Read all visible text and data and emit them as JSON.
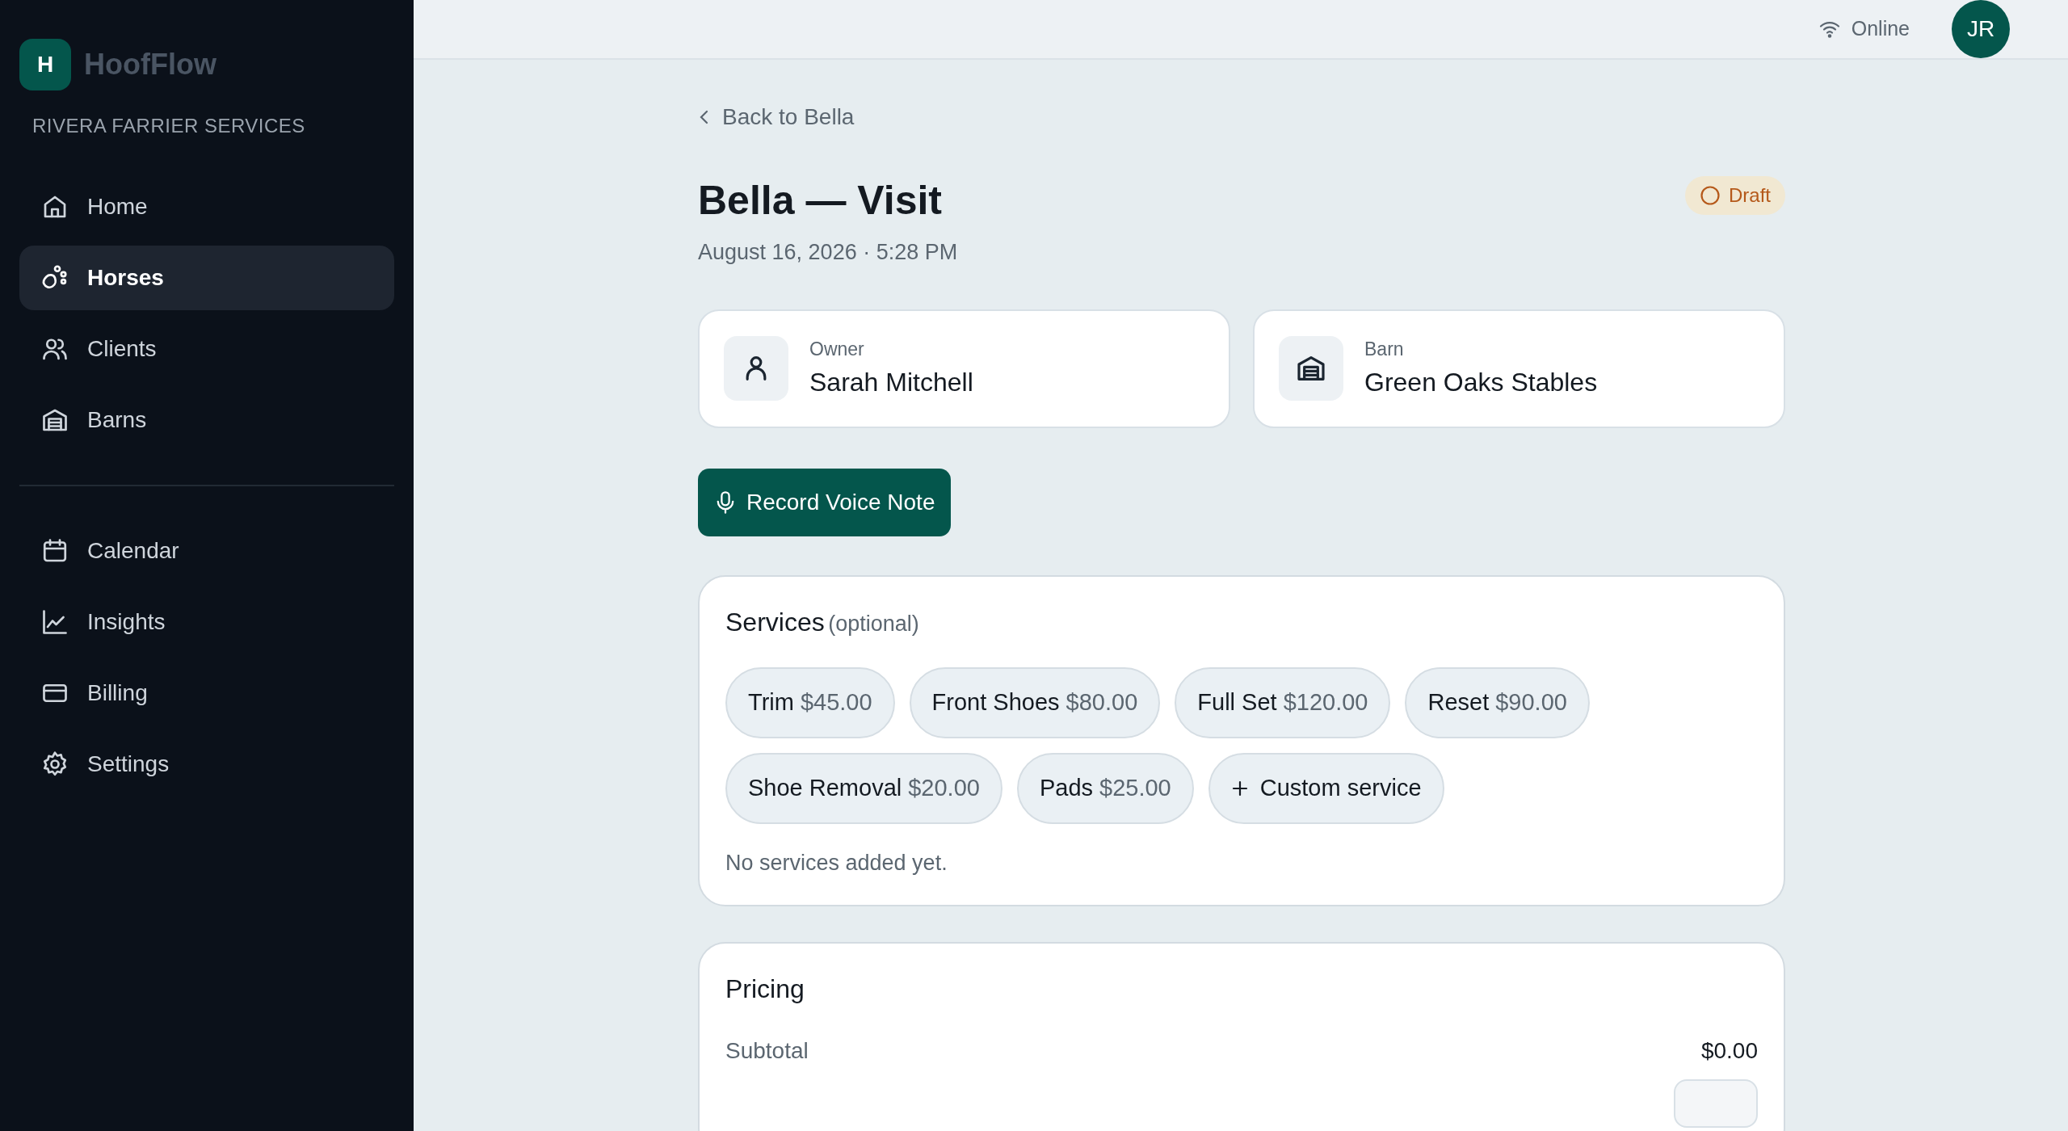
{
  "sidebar": {
    "logo_letter": "H",
    "app_name": "HoofFlow",
    "company": "RIVERA FARRIER SERVICES",
    "nav_groups": [
      [
        {
          "label": "Home",
          "selected": false
        },
        {
          "label": "Horses",
          "selected": true
        },
        {
          "label": "Clients",
          "selected": false
        },
        {
          "label": "Barns",
          "selected": false
        }
      ],
      [
        {
          "label": "Calendar",
          "selected": false
        },
        {
          "label": "Insights",
          "selected": false
        },
        {
          "label": "Billing",
          "selected": false
        },
        {
          "label": "Settings",
          "selected": false
        }
      ]
    ]
  },
  "header": {
    "status": "Online",
    "avatar": "JR"
  },
  "back_link": "Back to Bella",
  "title": "Bella — Visit",
  "status_badge": "Draft",
  "datetime": "August 16, 2026 · 5:28 PM",
  "info_cards": [
    {
      "kind": "owner",
      "label": "Owner",
      "value": "Sarah Mitchell"
    },
    {
      "kind": "barn",
      "label": "Barn",
      "value": "Green Oaks Stables"
    }
  ],
  "record_button": "Record Voice Note",
  "services": {
    "title": "Services",
    "hint": "(optional)",
    "chips": [
      {
        "kind": "service",
        "name": "Trim",
        "price": "$45.00"
      },
      {
        "kind": "service",
        "name": "Front Shoes",
        "price": "$80.00"
      },
      {
        "kind": "service",
        "name": "Full Set",
        "price": "$120.00"
      },
      {
        "kind": "service",
        "name": "Reset",
        "price": "$90.00"
      },
      {
        "kind": "service",
        "name": "Shoe Removal",
        "price": "$20.00"
      },
      {
        "kind": "service",
        "name": "Pads",
        "price": "$25.00"
      },
      {
        "kind": "custom",
        "name": "Custom service"
      }
    ],
    "empty_text": "No services added yet."
  },
  "pricing": {
    "title": "Pricing",
    "rows": [
      {
        "label": "Subtotal",
        "value": "$0.00"
      }
    ]
  }
}
